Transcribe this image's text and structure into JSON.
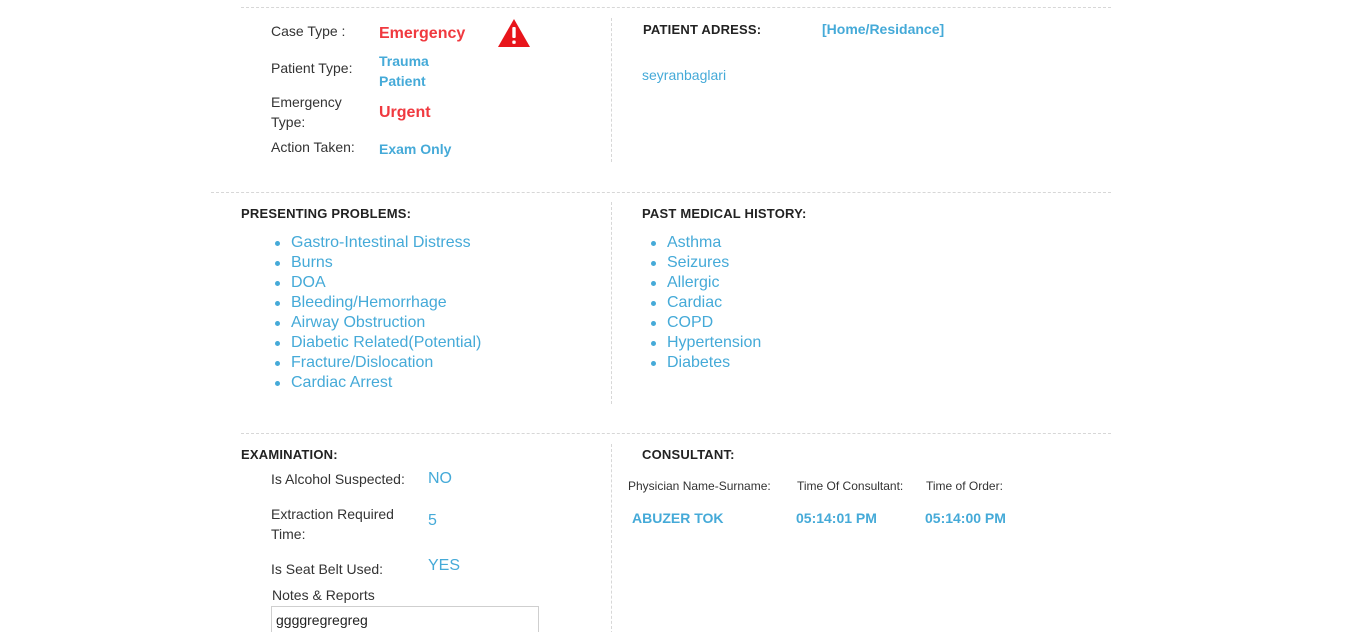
{
  "case_info": {
    "case_type_label": "Case Type :",
    "case_type_value": "Emergency",
    "warning_icon": "warning-triangle-icon",
    "patient_type_label": "Patient Type:",
    "patient_type_value_line1": "Trauma",
    "patient_type_value_line2": "Patient",
    "emergency_type_label": "Emergency Type:",
    "emergency_type_value": "Urgent",
    "action_taken_label": "Action Taken:",
    "action_taken_value": "Exam Only"
  },
  "address": {
    "heading": "PATIENT ADRESS:",
    "type": "[Home/Residance]",
    "value": "seyranbaglari"
  },
  "presenting_problems": {
    "heading": "PRESENTING PROBLEMS:",
    "items": [
      "Gastro-Intestinal Distress",
      "Burns",
      "DOA",
      "Bleeding/Hemorrhage",
      "Airway Obstruction",
      "Diabetic Related(Potential)",
      "Fracture/Dislocation",
      "Cardiac Arrest"
    ]
  },
  "past_medical_history": {
    "heading": "PAST MEDICAL HISTORY:",
    "items": [
      "Asthma",
      "Seizures",
      "Allergic",
      "Cardiac",
      "COPD",
      "Hypertension",
      "Diabetes"
    ]
  },
  "examination": {
    "heading": "EXAMINATION:",
    "alcohol_label": "Is Alcohol Suspected:",
    "alcohol_value": "NO",
    "extraction_label": "Extraction Required Time:",
    "extraction_value": "5",
    "seatbelt_label": "Is Seat Belt Used:",
    "seatbelt_value": "YES",
    "notes_label": "Notes & Reports",
    "notes_value": "ggggregregreg"
  },
  "consultant": {
    "heading": "CONSULTANT:",
    "col_physician": "Physician Name-Surname:",
    "col_time_consultant": "Time Of Consultant:",
    "col_time_order": "Time of Order:",
    "physician": "ABUZER TOK",
    "time_consultant": "05:14:01 PM",
    "time_order": "05:14:00 PM"
  },
  "colors": {
    "accent_blue": "#45aad8",
    "alert_red": "#f0393f",
    "divider": "#d7d7d7"
  }
}
